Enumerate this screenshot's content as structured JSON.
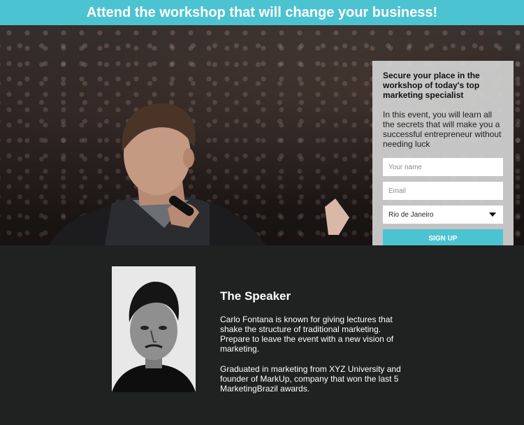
{
  "banner": {
    "title": "Attend the workshop that will change your business!"
  },
  "form": {
    "title": "Secure your place in the workshop of today's top marketing specialist",
    "description": "In this event, you will learn all the secrets that will make you a successful entrepreneur without needing luck",
    "name_placeholder": "Your name",
    "email_placeholder": "Email",
    "city_value": "Rio de Janeiro",
    "signup_label": "SIGN UP"
  },
  "speaker": {
    "heading": "The Speaker",
    "bio_1": "Carlo Fontana is known for giving lectures that shake the structure of traditional marketing. Prepare to leave the event with a new vision of marketing.",
    "bio_2": "Graduated in marketing from XYZ University and founder of MarkUp, company that won the last 5 MarketingBrazil awards."
  },
  "colors": {
    "accent": "#4cc3d1",
    "dark_bg": "#202121",
    "form_bg": "#d2d2d2"
  }
}
